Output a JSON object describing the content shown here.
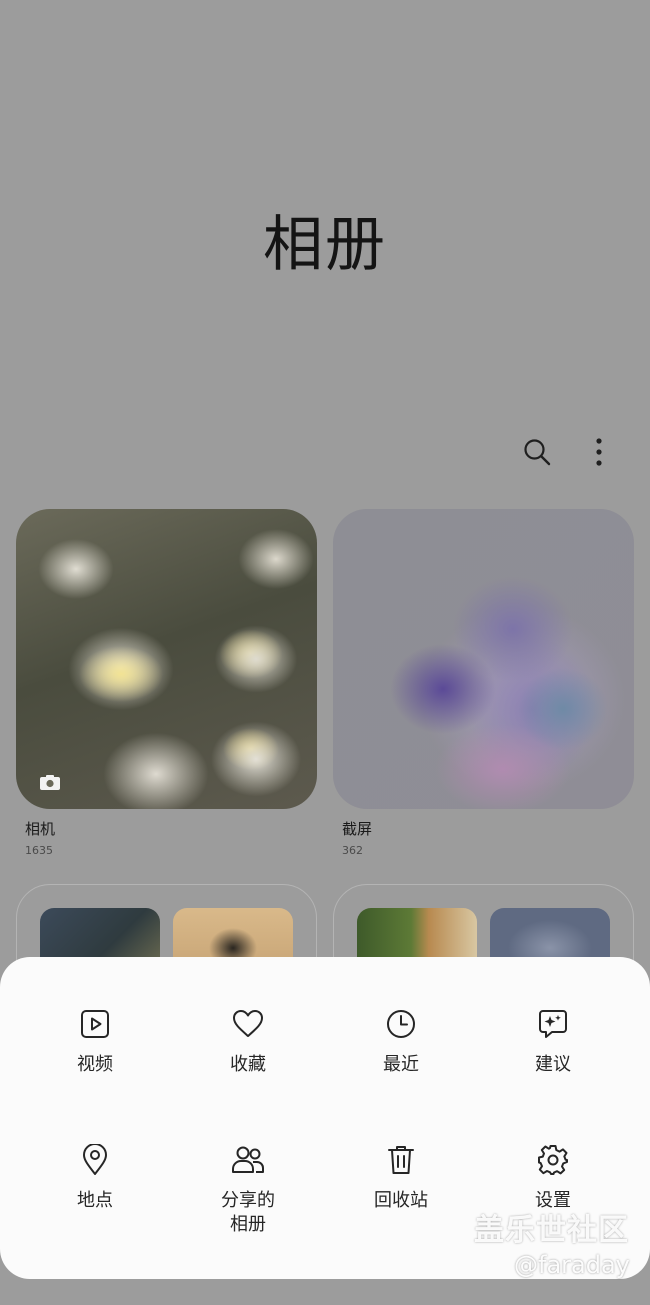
{
  "header": {
    "title": "相册"
  },
  "toolbar": {
    "search_icon": "search-icon",
    "more_icon": "more-vertical-icon"
  },
  "albums": [
    {
      "name": "相机",
      "count": "1635",
      "badge_icon": "camera-icon"
    },
    {
      "name": "截屏",
      "count": "362"
    }
  ],
  "menu": {
    "items": [
      {
        "label": "视频",
        "icon": "play-square-icon"
      },
      {
        "label": "收藏",
        "icon": "heart-icon"
      },
      {
        "label": "最近",
        "icon": "clock-icon"
      },
      {
        "label": "建议",
        "icon": "sparkle-chat-icon"
      },
      {
        "label": "地点",
        "icon": "map-pin-icon"
      },
      {
        "label": "分享的\n相册",
        "label_line1": "分享的",
        "label_line2": "相册",
        "icon": "people-icon"
      },
      {
        "label": "回收站",
        "icon": "trash-icon"
      },
      {
        "label": "设置",
        "icon": "gear-icon"
      }
    ]
  },
  "watermark": {
    "line1": "盖乐世社区",
    "line2": "@faraday"
  },
  "colors": {
    "scrim": "#9c9c9c",
    "sheet": "#fbfbfb",
    "icon": "#262626"
  }
}
